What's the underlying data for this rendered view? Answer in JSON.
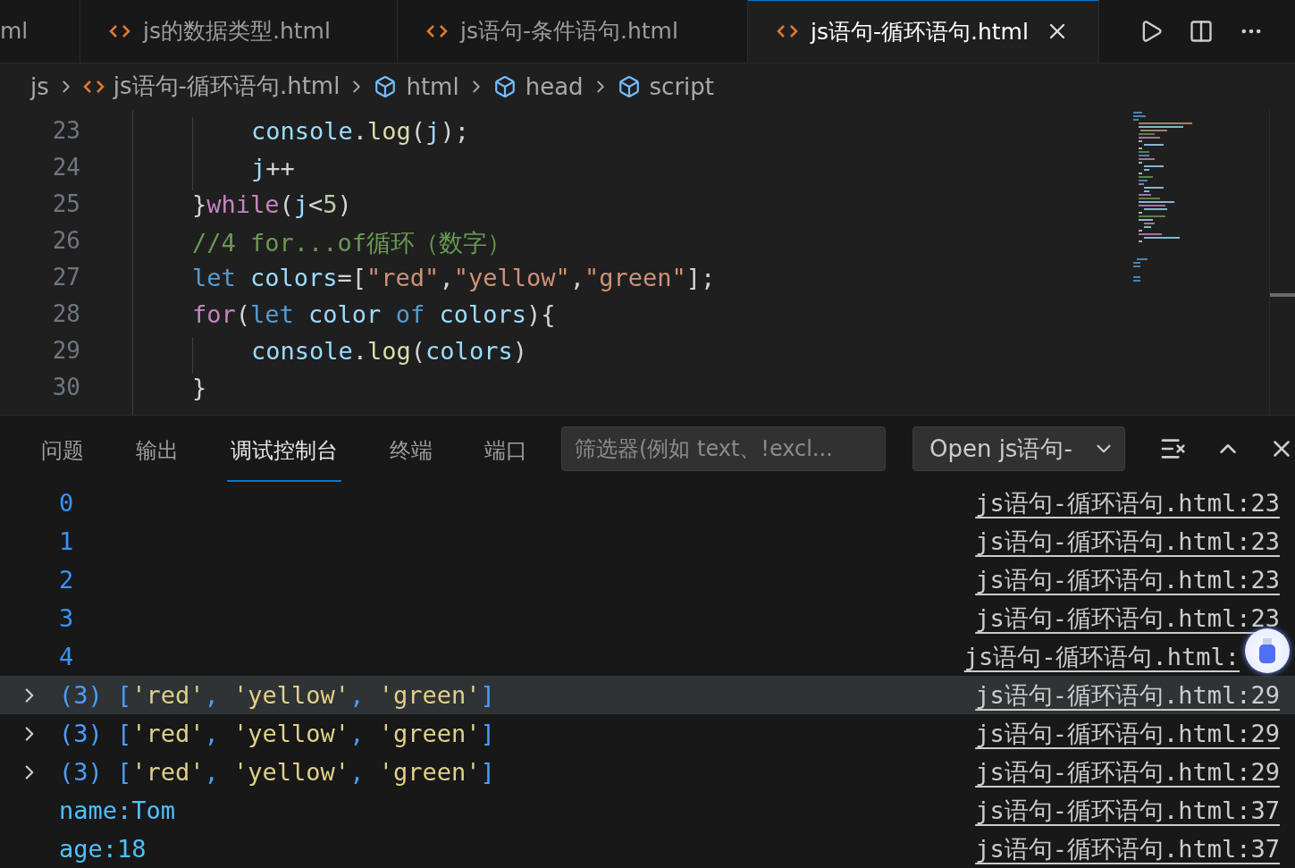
{
  "tabs": [
    {
      "label": "ml",
      "kind": "clipped",
      "selected": false
    },
    {
      "label": "js的数据类型.html",
      "kind": "file",
      "selected": false
    },
    {
      "label": "js语句-条件语句.html",
      "kind": "file",
      "selected": false
    },
    {
      "label": "js语句-循环语句.html",
      "kind": "file",
      "selected": true
    }
  ],
  "breadcrumb": [
    {
      "label": "js",
      "kind": "folder"
    },
    {
      "label": "js语句-循环语句.html",
      "kind": "file"
    },
    {
      "label": "html",
      "kind": "symbol"
    },
    {
      "label": "head",
      "kind": "symbol"
    },
    {
      "label": "script",
      "kind": "symbol"
    }
  ],
  "editor": {
    "lines": [
      {
        "children": [
          {
            "number": "23",
            "tokens": [
              {
                "text": "console",
                "kind": "var"
              },
              {
                "text": ".",
                "kind": "punct"
              },
              {
                "text": "log",
                "kind": "fn"
              },
              {
                "text": "(",
                "kind": "punct"
              },
              {
                "text": "j",
                "kind": "var"
              },
              {
                "text": ");",
                "kind": "punct"
              }
            ]
          },
          {
            "number": "24",
            "tokens": [
              {
                "text": "j",
                "kind": "var"
              },
              {
                "text": "++",
                "kind": "punct"
              }
            ]
          }
        ]
      },
      {
        "number": "25",
        "tokens": [
          {
            "text": "}",
            "kind": "punct"
          },
          {
            "text": "while",
            "kind": "ctrl"
          },
          {
            "text": "(",
            "kind": "punct"
          },
          {
            "text": "j",
            "kind": "var"
          },
          {
            "text": "<",
            "kind": "punct"
          },
          {
            "text": "5",
            "kind": "num"
          },
          {
            "text": ")",
            "kind": "punct"
          }
        ]
      },
      {
        "number": "26",
        "tokens": [
          {
            "text": "//4 for...of循环（数字）",
            "kind": "comment"
          }
        ]
      },
      {
        "number": "27",
        "tokens": [
          {
            "text": "let",
            "kind": "kw"
          },
          {
            "text": " colors",
            "kind": "var"
          },
          {
            "text": "=[",
            "kind": "punct"
          },
          {
            "text": "\"red\"",
            "kind": "str"
          },
          {
            "text": ",",
            "kind": "punct"
          },
          {
            "text": "\"yellow\"",
            "kind": "str"
          },
          {
            "text": ",",
            "kind": "punct"
          },
          {
            "text": "\"green\"",
            "kind": "str"
          },
          {
            "text": "];",
            "kind": "punct"
          }
        ]
      },
      {
        "number": "28",
        "tokens": [
          {
            "text": "for",
            "kind": "ctrl"
          },
          {
            "text": "(",
            "kind": "punct"
          },
          {
            "text": "let",
            "kind": "kw"
          },
          {
            "text": " color ",
            "kind": "var"
          },
          {
            "text": "of",
            "kind": "kw"
          },
          {
            "text": " colors",
            "kind": "var"
          },
          {
            "text": "){",
            "kind": "punct"
          }
        ],
        "children": [
          {
            "number": "29",
            "tokens": [
              {
                "text": "console",
                "kind": "var"
              },
              {
                "text": ".",
                "kind": "punct"
              },
              {
                "text": "log",
                "kind": "fn"
              },
              {
                "text": "(",
                "kind": "punct"
              },
              {
                "text": "colors",
                "kind": "var"
              },
              {
                "text": ")",
                "kind": "punct"
              }
            ]
          }
        ]
      },
      {
        "number": "30",
        "tokens": [
          {
            "text": "}",
            "kind": "punct"
          }
        ]
      }
    ]
  },
  "panel": {
    "tabs": [
      {
        "label": "问题",
        "selected": false
      },
      {
        "label": "输出",
        "selected": false
      },
      {
        "label": "调试控制台",
        "selected": true
      },
      {
        "label": "终端",
        "selected": false
      },
      {
        "label": "端口",
        "selected": false
      }
    ],
    "filter": {
      "placeholder": "筛选器(例如 text、!excl..."
    },
    "session": "Open js语句-"
  },
  "console": [
    {
      "expandable": false,
      "highlighted": false,
      "tokens": [
        {
          "text": "0",
          "kind": "num"
        }
      ],
      "source": "js语句-循环语句.html:23"
    },
    {
      "expandable": false,
      "highlighted": false,
      "tokens": [
        {
          "text": "1",
          "kind": "num"
        }
      ],
      "source": "js语句-循环语句.html:23"
    },
    {
      "expandable": false,
      "highlighted": false,
      "tokens": [
        {
          "text": "2",
          "kind": "num"
        }
      ],
      "source": "js语句-循环语句.html:23"
    },
    {
      "expandable": false,
      "highlighted": false,
      "tokens": [
        {
          "text": "3",
          "kind": "num"
        }
      ],
      "source": "js语句-循环语句.html:23"
    },
    {
      "expandable": false,
      "highlighted": false,
      "tokens": [
        {
          "text": "4",
          "kind": "num"
        }
      ],
      "source": "js语句-循环语句.html:"
    },
    {
      "expandable": true,
      "highlighted": true,
      "tokens": [
        {
          "text": "(3) [",
          "kind": "meta"
        },
        {
          "text": "'red'",
          "kind": "str"
        },
        {
          "text": ", ",
          "kind": "meta"
        },
        {
          "text": "'yellow'",
          "kind": "str"
        },
        {
          "text": ", ",
          "kind": "meta"
        },
        {
          "text": "'green'",
          "kind": "str"
        },
        {
          "text": "]",
          "kind": "meta"
        }
      ],
      "source": "js语句-循环语句.html:29"
    },
    {
      "expandable": true,
      "highlighted": false,
      "tokens": [
        {
          "text": "(3) [",
          "kind": "meta"
        },
        {
          "text": "'red'",
          "kind": "str"
        },
        {
          "text": ", ",
          "kind": "meta"
        },
        {
          "text": "'yellow'",
          "kind": "str"
        },
        {
          "text": ", ",
          "kind": "meta"
        },
        {
          "text": "'green'",
          "kind": "str"
        },
        {
          "text": "]",
          "kind": "meta"
        }
      ],
      "source": "js语句-循环语句.html:29"
    },
    {
      "expandable": true,
      "highlighted": false,
      "tokens": [
        {
          "text": "(3) [",
          "kind": "meta"
        },
        {
          "text": "'red'",
          "kind": "str"
        },
        {
          "text": ", ",
          "kind": "meta"
        },
        {
          "text": "'yellow'",
          "kind": "str"
        },
        {
          "text": ", ",
          "kind": "meta"
        },
        {
          "text": "'green'",
          "kind": "str"
        },
        {
          "text": "]",
          "kind": "meta"
        }
      ],
      "source": "js语句-循环语句.html:29"
    },
    {
      "expandable": false,
      "highlighted": false,
      "tokens": [
        {
          "text": "name:Tom",
          "kind": "text"
        }
      ],
      "source": "js语句-循环语句.html:37"
    },
    {
      "expandable": false,
      "highlighted": false,
      "tokens": [
        {
          "text": "age:18",
          "kind": "text"
        }
      ],
      "source": "js语句-循环语句.html:37"
    }
  ]
}
